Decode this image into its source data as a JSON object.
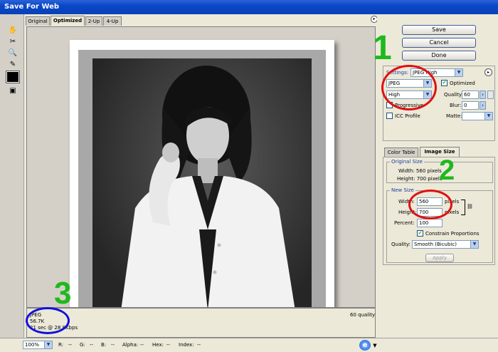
{
  "window": {
    "title": "Save For Web"
  },
  "tabs": [
    {
      "label": "Original"
    },
    {
      "label": "Optimized"
    },
    {
      "label": "2-Up"
    },
    {
      "label": "4-Up"
    }
  ],
  "actions": {
    "save": "Save",
    "cancel": "Cancel",
    "done": "Done"
  },
  "settings": {
    "label": "Settings:",
    "preset": "JPEG High",
    "format": "JPEG",
    "quality_level": "High",
    "optimized_label": "Optimized",
    "quality_label": "Quality:",
    "quality_value": "60",
    "progressive_label": "Progressive",
    "blur_label": "Blur:",
    "blur_value": "0",
    "icc_label": "ICC Profile",
    "matte_label": "Matte:"
  },
  "panel_tabs": [
    {
      "label": "Color Table"
    },
    {
      "label": "Image Size"
    }
  ],
  "original_size": {
    "title": "Original Size",
    "width_line": "Width: 560 pixels",
    "height_line": "Height: 700 pixels"
  },
  "new_size": {
    "title": "New Size",
    "width_label": "Width:",
    "width_value": "560",
    "height_label": "Height:",
    "height_value": "700",
    "pixels_unit": "pixels",
    "percent_label": "Percent:",
    "percent_value": "100",
    "constrain_label": "Constrain Proportions",
    "quality_label": "Quality:",
    "quality_value": "Smooth (Bicubic)",
    "apply_label": "Apply"
  },
  "info": {
    "format": "JPEG",
    "size": "56.7K",
    "download": "21 sec @ 28.8Kbps",
    "quality": "60 quality"
  },
  "status": {
    "zoom": "100%",
    "r": "R:",
    "r_val": "--",
    "g": "G:",
    "g_val": "--",
    "b": "B:",
    "b_val": "--",
    "alpha": "Alpha:",
    "alpha_val": "--",
    "hex": "Hex:",
    "hex_val": "--",
    "index": "Index:",
    "index_val": "--"
  },
  "annotations": {
    "n1": "1",
    "n2": "2",
    "n3": "3"
  },
  "colors": {
    "titlebar": "#0a46c8",
    "annotation_green": "#1db91d",
    "annotation_red": "#e01010",
    "annotation_blue": "#1010e0"
  }
}
